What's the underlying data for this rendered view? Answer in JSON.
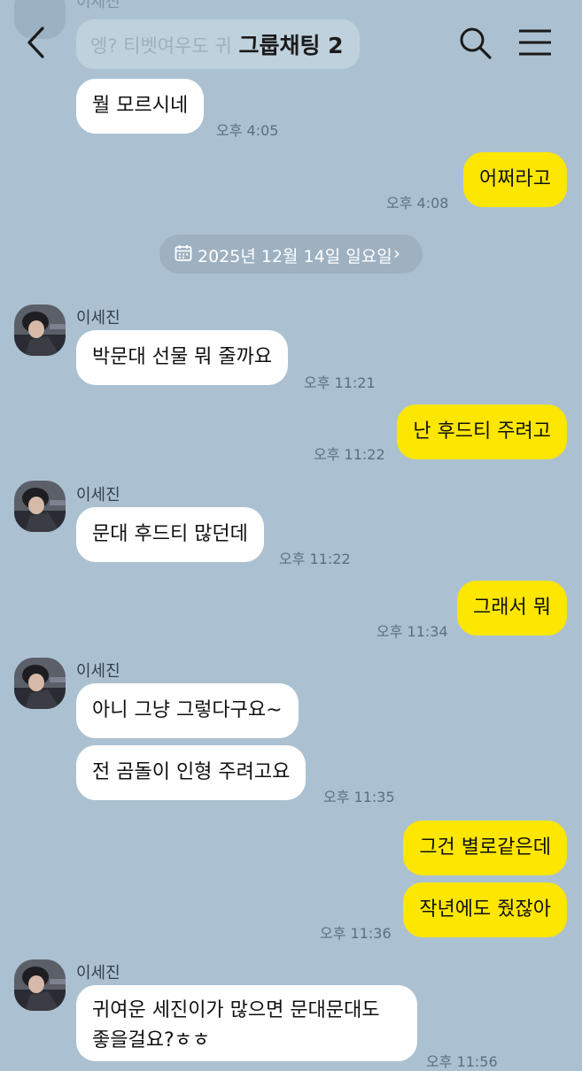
{
  "header": {
    "title": "그룹채팅 2"
  },
  "peek": {
    "name": "이세진",
    "text": "엥? 티벳여우도 귀"
  },
  "date_divider": {
    "label": "2025년 12월 14일 일요일",
    "chevron": "›"
  },
  "messages": [
    {
      "text": "뭘 모르시네",
      "time": "오후 4:05"
    },
    {
      "text": "어쩌라고",
      "time": "오후 4:08"
    },
    {
      "name": "이세진",
      "text": "박문대 선물 뭐 줄까요",
      "time": "오후 11:21"
    },
    {
      "text": "난 후드티 주려고",
      "time": "오후 11:22"
    },
    {
      "name": "이세진",
      "text": "문대 후드티 많던데",
      "time": "오후 11:22"
    },
    {
      "text": "그래서 뭐",
      "time": "오후 11:34"
    },
    {
      "name": "이세진",
      "text": "아니 그냥 그렇다구요~"
    },
    {
      "text": "전 곰돌이 인형 주려고요",
      "time": "오후 11:35"
    },
    {
      "text": "그건 별로같은데"
    },
    {
      "text": "작년에도 줬잖아",
      "time": "오후 11:36"
    },
    {
      "name": "이세진",
      "text": "귀여운 세진이가 많으면 문대문대도 좋을걸요?ㅎㅎ",
      "time": "오후 11:56"
    }
  ],
  "icons": {
    "back": "back-arrow-icon",
    "search": "search-icon",
    "menu": "hamburger-menu-icon",
    "calendar": "calendar-icon"
  },
  "colors": {
    "background": "#abc1d1",
    "outgoing_bubble": "#fde600",
    "incoming_bubble": "#ffffff"
  }
}
